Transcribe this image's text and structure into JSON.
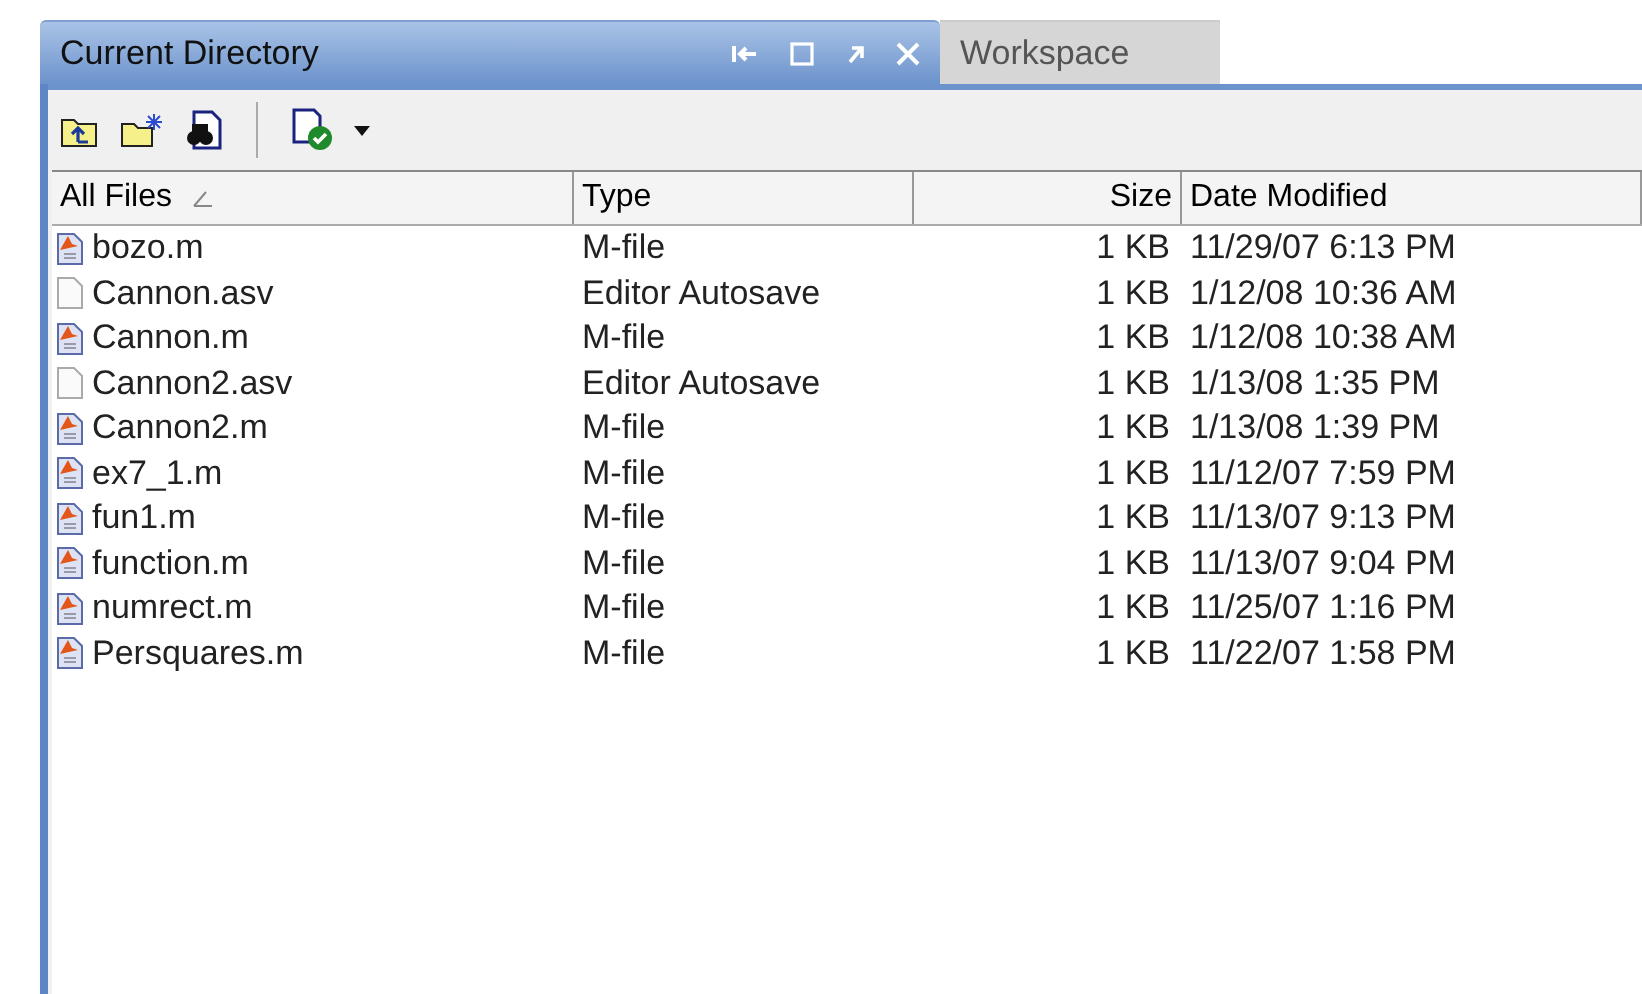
{
  "tabs": [
    {
      "label": "Current Directory",
      "selected": true
    },
    {
      "label": "Workspace",
      "selected": false
    }
  ],
  "table": {
    "columns": [
      {
        "label": "All Files",
        "sorted": true
      },
      {
        "label": "Type",
        "sorted": false
      },
      {
        "label": "Size",
        "sorted": false
      },
      {
        "label": "Date Modified",
        "sorted": false
      }
    ],
    "rows": [
      {
        "kind": "m",
        "name": "bozo.m",
        "type": "M-file",
        "size": "1 KB",
        "date": "11/29/07 6:13 PM"
      },
      {
        "kind": "asv",
        "name": "Cannon.asv",
        "type": "Editor Autosave",
        "size": "1 KB",
        "date": "1/12/08 10:36 AM"
      },
      {
        "kind": "m",
        "name": "Cannon.m",
        "type": "M-file",
        "size": "1 KB",
        "date": "1/12/08 10:38 AM"
      },
      {
        "kind": "asv",
        "name": "Cannon2.asv",
        "type": "Editor Autosave",
        "size": "1 KB",
        "date": "1/13/08 1:35 PM"
      },
      {
        "kind": "m",
        "name": "Cannon2.m",
        "type": "M-file",
        "size": "1 KB",
        "date": "1/13/08 1:39 PM"
      },
      {
        "kind": "m",
        "name": "ex7_1.m",
        "type": "M-file",
        "size": "1 KB",
        "date": "11/12/07 7:59 PM"
      },
      {
        "kind": "m",
        "name": "fun1.m",
        "type": "M-file",
        "size": "1 KB",
        "date": "11/13/07 9:13 PM"
      },
      {
        "kind": "m",
        "name": "function.m",
        "type": "M-file",
        "size": "1 KB",
        "date": "11/13/07 9:04 PM"
      },
      {
        "kind": "m",
        "name": "numrect.m",
        "type": "M-file",
        "size": "1 KB",
        "date": "11/25/07 1:16 PM"
      },
      {
        "kind": "m",
        "name": "Persquares.m",
        "type": "M-file",
        "size": "1 KB",
        "date": "11/22/07 1:58 PM"
      }
    ]
  }
}
